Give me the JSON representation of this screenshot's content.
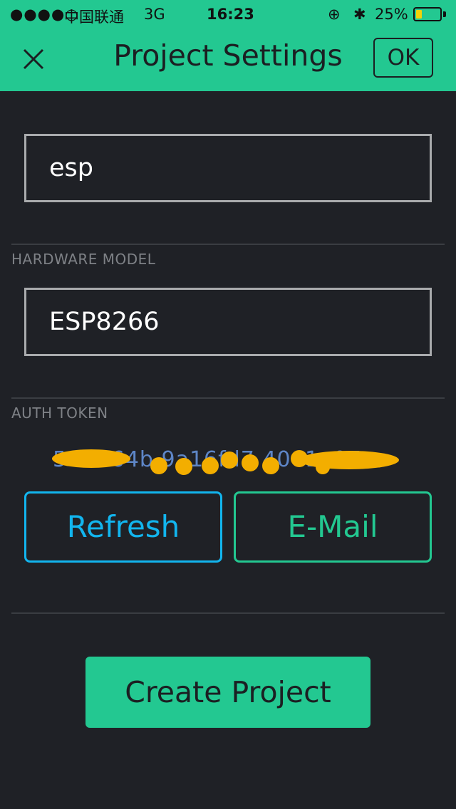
{
  "status_bar": {
    "signal": "●●●●○",
    "carrier": "中国联通",
    "network": "3G",
    "time": "16:23",
    "lock_icon": "⊕",
    "bluetooth_icon": "✱",
    "battery_percent": "25%",
    "battery_level": 0.25
  },
  "header": {
    "close_icon": "close-icon",
    "title": "Project Settings",
    "ok_label": "OK",
    "background": "#23c891"
  },
  "project": {
    "name_value": "esp"
  },
  "hardware": {
    "section_label": "HARDWARE MODEL",
    "model_value": "ESP8266"
  },
  "auth": {
    "section_label": "AUTH TOKEN",
    "token_visible": "5       f4e64b 9a16fd7    40e1e07"
  },
  "actions": {
    "refresh_label": "Refresh",
    "email_label": "E-Mail",
    "create_label": "Create Project"
  },
  "colors": {
    "accent_green": "#23c891",
    "accent_blue": "#12b5ee",
    "background": "#1f2126",
    "redaction": "#f3ae00"
  }
}
